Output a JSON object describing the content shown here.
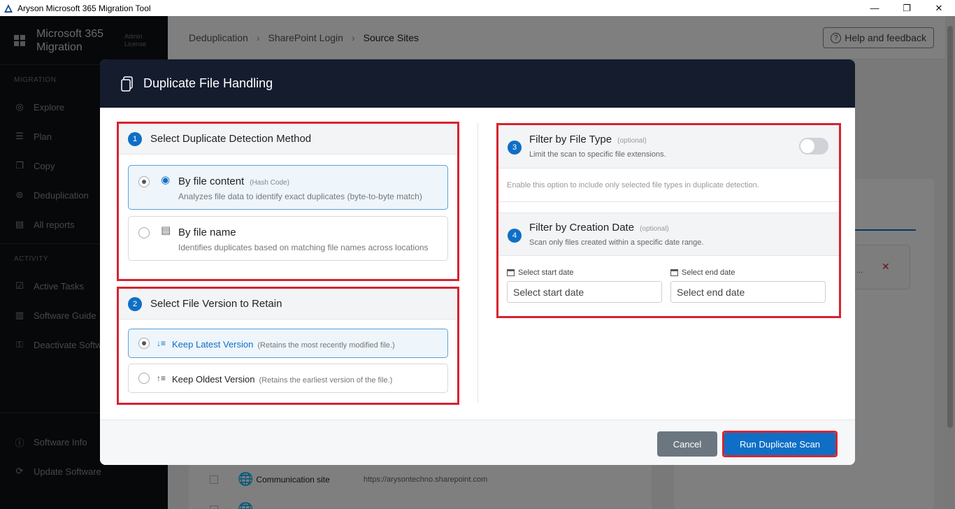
{
  "window": {
    "title": "Aryson Microsoft 365 Migration Tool",
    "minimize": "—",
    "restore": "❐",
    "close": "✕"
  },
  "sidebar": {
    "brand": "Microsoft 365 Migration",
    "license_line1": "Admin",
    "license_line2": "License",
    "migration_label": "MIGRATION",
    "migration_items": [
      {
        "label": "Explore",
        "icon": "compass-icon"
      },
      {
        "label": "Plan",
        "icon": "list-icon"
      },
      {
        "label": "Copy",
        "icon": "copy-icon"
      },
      {
        "label": "Deduplication",
        "icon": "dedup-icon"
      },
      {
        "label": "All reports",
        "icon": "report-icon"
      }
    ],
    "activity_label": "ACTIVITY",
    "activity_items": [
      {
        "label": "Active Tasks",
        "icon": "check-icon"
      },
      {
        "label": "Software Guide",
        "icon": "guide-icon"
      },
      {
        "label": "Deactivate Softw",
        "icon": "key-icon"
      }
    ],
    "bottom_items": [
      {
        "label": "Software Info",
        "icon": "info-icon"
      },
      {
        "label": "Update Software",
        "icon": "update-icon"
      }
    ]
  },
  "header": {
    "breadcrumb": [
      "Deduplication",
      "SharePoint Login",
      "Source Sites"
    ],
    "help": "Help and feedback"
  },
  "background": {
    "rows": [
      {
        "name": "Communication site",
        "url": "https://arysontechno.sharepoint.com"
      },
      {
        "name": "",
        "url": ""
      }
    ],
    "close_glyph": "✕",
    "ellipsis": "..."
  },
  "modal": {
    "title": "Duplicate File Handling",
    "detection": {
      "step": "1",
      "title": "Select Duplicate Detection Method",
      "options": [
        {
          "title": "By file content",
          "tag": "(Hash Code)",
          "desc": "Analyzes file data to identify exact duplicates (byte-to-byte match)"
        },
        {
          "title": "By file name",
          "tag": "",
          "desc": "Identifies duplicates based on matching file names across locations"
        }
      ]
    },
    "version": {
      "step": "2",
      "title": "Select File Version to Retain",
      "options": [
        {
          "title": "Keep Latest Version",
          "desc": "(Retains the most recently modified file.)"
        },
        {
          "title": "Keep Oldest Version",
          "desc": "(Retains the earliest version of the file.)"
        }
      ]
    },
    "file_type": {
      "step": "3",
      "title": "Filter by File Type",
      "optional": "(optional)",
      "subtitle": "Limit the scan to specific file extensions.",
      "note": "Enable this option to include only selected file types in duplicate detection."
    },
    "creation_date": {
      "step": "4",
      "title": "Filter by Creation Date",
      "optional": "(optional)",
      "subtitle": "Scan only files created within a specific date range.",
      "start_label": "Select start date",
      "start_placeholder": "Select start date",
      "end_label": "Select end date",
      "end_placeholder": "Select end date"
    },
    "cancel": "Cancel",
    "run": "Run Duplicate Scan"
  }
}
